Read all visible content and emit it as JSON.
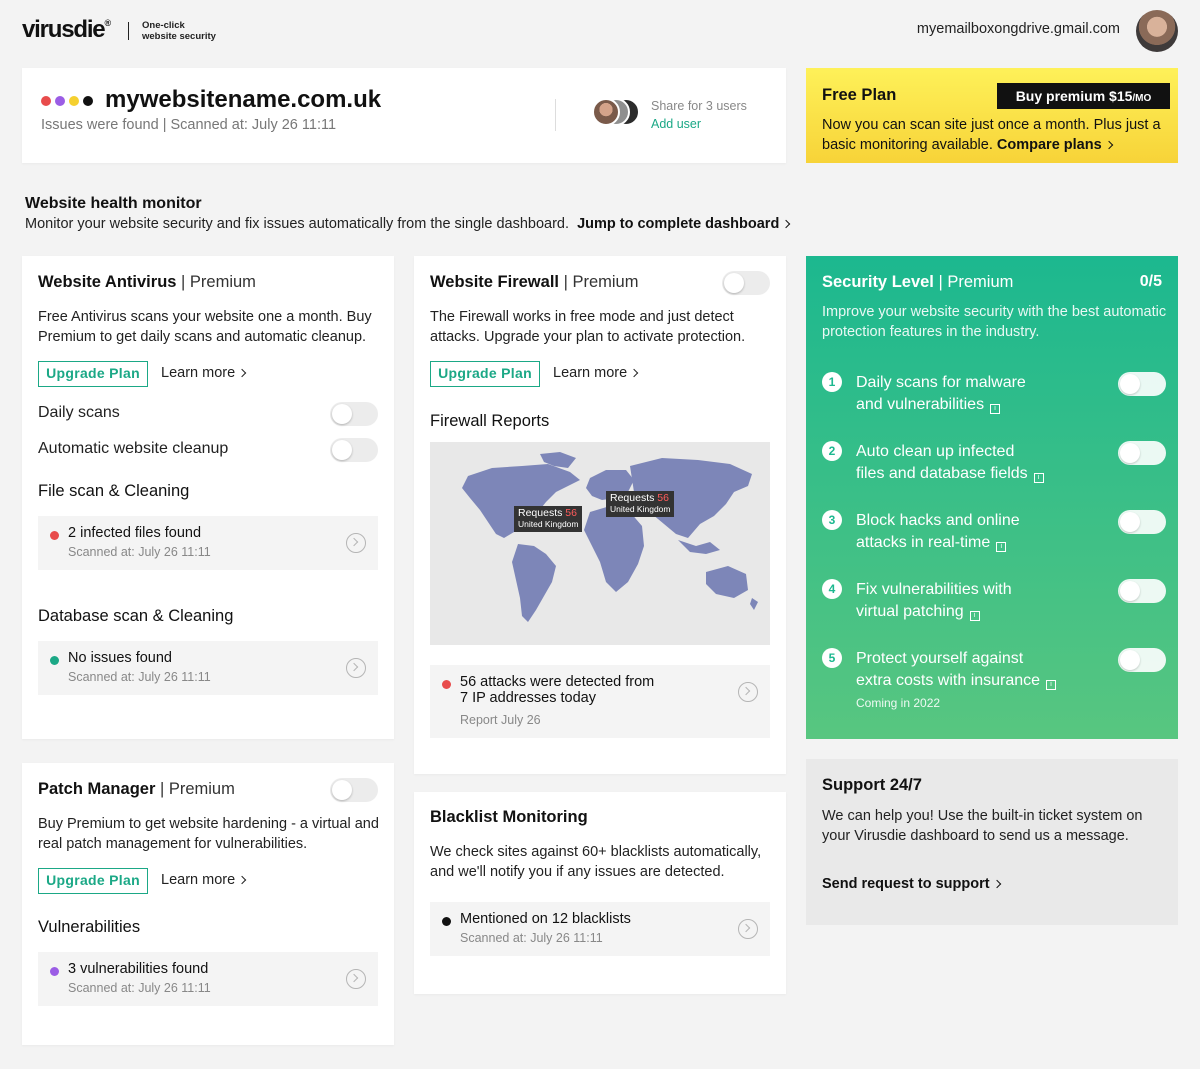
{
  "header": {
    "logo": "virusdie",
    "logo_mark": "®",
    "tagline_1": "One-click",
    "tagline_2": "website security",
    "email": "myemailboxongdrive.gmail.com"
  },
  "site": {
    "name": "mywebsitename.com.uk",
    "subtitle": "Issues were found | Scanned at: July 26  11:11",
    "dot_colors": [
      "#e84c4c",
      "#9b5de5",
      "#f5d02f",
      "#111111"
    ],
    "share_text": "Share for 3 users",
    "add_user": "Add user"
  },
  "free_plan": {
    "title": "Free Plan",
    "buy_label": "Buy premium $15",
    "buy_unit": "/MO",
    "text": "Now you can scan site just once a month. Plus just a basic monitoring available.",
    "compare": "Compare plans"
  },
  "health": {
    "title": "Website health monitor",
    "subtitle": "Monitor your website security and fix issues automatically from the single dashboard.",
    "jump": "Jump to complete dashboard"
  },
  "antivirus": {
    "title": "Website Antivirus",
    "tier": "| Premium",
    "text": "Free Antivirus scans your website one a month. Buy Premium to get daily scans and automatic cleanup.",
    "upgrade": "Upgrade Plan",
    "learn": "Learn more",
    "toggle_daily": "Daily scans",
    "toggle_cleanup": "Automatic website cleanup",
    "file_title": "File scan & Cleaning",
    "file_status": "2 infected files found",
    "file_scanned": "Scanned at: July 26  11:11",
    "db_title": "Database scan & Cleaning",
    "db_status": "No issues found",
    "db_scanned": "Scanned at: July 26  11:11"
  },
  "firewall": {
    "title": "Website Firewall",
    "tier": "| Premium",
    "text": "The Firewall works in free mode and just detect attacks. Upgrade your plan to activate protection.",
    "upgrade": "Upgrade Plan",
    "learn": "Learn more",
    "reports_title": "Firewall Reports",
    "tip1_label": "Requests",
    "tip1_count": "56",
    "tip1_country": "United Kingdom",
    "tip2_label": "Requests",
    "tip2_count": "56",
    "tip2_country": "United Kingdom",
    "status_line1": "56 attacks were detected from",
    "status_line2": "7 IP addresses today",
    "report_date": "Report July 26"
  },
  "patch": {
    "title": "Patch Manager",
    "tier": "| Premium",
    "text": "Buy Premium to get website hardening - a virtual and real patch management for vulnerabilities.",
    "upgrade": "Upgrade Plan",
    "learn": "Learn more",
    "vuln_title": "Vulnerabilities",
    "vuln_status": "3 vulnerabilities found",
    "vuln_scanned": "Scanned at: July 26  11:11"
  },
  "blacklist": {
    "title": "Blacklist Monitoring",
    "text": "We check sites against 60+ blacklists automatically, and we'll notify you if any issues are detected.",
    "status": "Mentioned on 12 blacklists",
    "scanned": "Scanned at: July 26  11:11"
  },
  "security": {
    "title": "Security Level",
    "tier": "| Premium",
    "score": "0/5",
    "text": "Improve your website security with the best automatic protection features in the industry.",
    "features": [
      {
        "num": "1",
        "line1": "Daily scans for malware",
        "line2": "and vulnerabilities"
      },
      {
        "num": "2",
        "line1": "Auto clean up infected",
        "line2": "files and database fields"
      },
      {
        "num": "3",
        "line1": "Block hacks and online",
        "line2": "attacks in real-time"
      },
      {
        "num": "4",
        "line1": "Fix vulnerabilities with",
        "line2": "virtual patching"
      },
      {
        "num": "5",
        "line1": "Protect yourself against",
        "line2": "extra costs with insurance"
      }
    ],
    "coming": "Coming in 2022"
  },
  "support": {
    "title": "Support 24/7",
    "text": "We can help you! Use the built-in ticket system on your Virusdie dashboard to send us a message.",
    "link": "Send request to support"
  },
  "colors": {
    "accent": "#1ba886",
    "red": "#e84c4c",
    "green": "#1ba886",
    "purple": "#9b5de5",
    "black": "#111111",
    "map": "#7d86b8"
  }
}
